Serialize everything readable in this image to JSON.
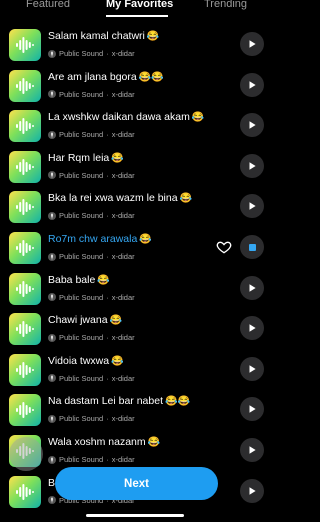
{
  "tabs": [
    {
      "label": "Featured",
      "active": false
    },
    {
      "label": "My Favorites",
      "active": true
    },
    {
      "label": "Trending",
      "active": false
    }
  ],
  "sounds": [
    {
      "title": "Salam kamal chatwri",
      "emoji": "😂",
      "source": "Public Sound",
      "author": "x-didar",
      "state": "idle"
    },
    {
      "title": "Are am jlana bgora",
      "emoji": "😂😂",
      "source": "Public Sound",
      "author": "x-didar",
      "state": "idle"
    },
    {
      "title": "La xwshkw daikan dawa akam",
      "emoji": "😂",
      "source": "Public Sound",
      "author": "x-didar",
      "state": "idle"
    },
    {
      "title": "Har Rqm leia",
      "emoji": "😂",
      "source": "Public Sound",
      "author": "x-didar",
      "state": "idle"
    },
    {
      "title": "Bka la rei xwa wazm le bina",
      "emoji": "😂",
      "source": "Public Sound",
      "author": "x-didar",
      "state": "idle"
    },
    {
      "title": "Ro7m chw arawala",
      "emoji": "😂",
      "source": "Public Sound",
      "author": "x-didar",
      "state": "playing"
    },
    {
      "title": "Baba bale",
      "emoji": "😂",
      "source": "Public Sound",
      "author": "x-didar",
      "state": "idle"
    },
    {
      "title": "Chawi jwana",
      "emoji": "😂",
      "source": "Public Sound",
      "author": "x-didar",
      "state": "idle"
    },
    {
      "title": "Vidoia twxwa",
      "emoji": "😂",
      "source": "Public Sound",
      "author": "x-didar",
      "state": "idle"
    },
    {
      "title": "Na dastam Lei bar nabet",
      "emoji": "😂😂",
      "source": "Public Sound",
      "author": "x-didar",
      "state": "idle"
    },
    {
      "title": "Wala xoshm nazanm",
      "emoji": "😂",
      "source": "Public Sound",
      "author": "x-didar",
      "state": "idle"
    },
    {
      "title": "Ba",
      "emoji": "",
      "source": "Public Sound",
      "author": "x-didar",
      "state": "idle"
    }
  ],
  "next_button": {
    "label": "Next"
  },
  "colors": {
    "accent": "#1e9df1",
    "playing_text": "#35a7f2",
    "background": "#000000"
  }
}
